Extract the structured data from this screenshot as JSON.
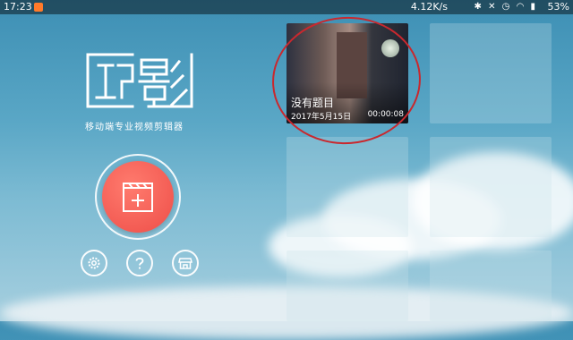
{
  "status_bar": {
    "time": "17:23",
    "net_speed": "4.12K/s",
    "icons": [
      "bluetooth-icon",
      "mute-icon",
      "alarm-icon",
      "wifi-icon",
      "signal-icon"
    ],
    "battery": "53%"
  },
  "app": {
    "name": "巧影",
    "tagline": "移动端专业视频剪辑器"
  },
  "actions": {
    "new_project_icon": "clapperboard-plus-icon",
    "settings_icon": "gear-icon",
    "help_icon": "question-icon",
    "store_icon": "store-icon"
  },
  "projects": [
    {
      "title": "没有题目",
      "date": "2017年5月15日",
      "duration": "00:00:08"
    }
  ],
  "colors": {
    "accent": "#ee4e48",
    "highlight_circle": "#c9282e"
  }
}
